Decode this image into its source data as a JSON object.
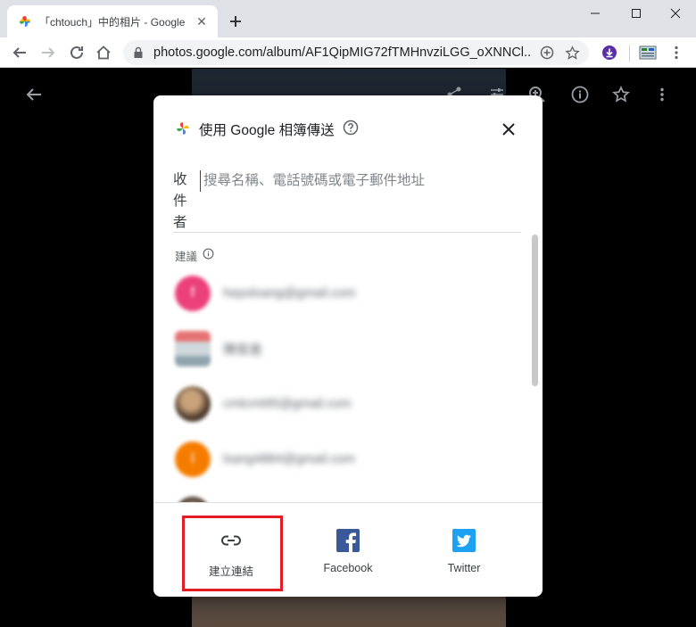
{
  "browser": {
    "tab_title": "「chtouch」中的相片 - Google",
    "url": "photos.google.com/album/AF1QipMIG72fTMHnvziLGG_oXNNCl..."
  },
  "dialog": {
    "title": "使用 Google 相簿傳送",
    "recipients_label": "收件者",
    "recipients_placeholder": "搜尋名稱、電話號碼或電子郵件地址",
    "suggestions_label": "建議",
    "contacts": [
      {
        "name": "hepoloang@gmail.com",
        "avatar_letter": "f",
        "avatar_color": "#ec407a"
      },
      {
        "name": "陳俊進",
        "avatar_letter": "",
        "avatar_color": "#b0bec5"
      },
      {
        "name": "cmtcmt95@gmail.com",
        "avatar_letter": "",
        "avatar_color": "#6d5a4a"
      },
      {
        "name": "lsang4884@gmail.com",
        "avatar_letter": "l",
        "avatar_color": "#f57c00"
      }
    ],
    "share_options": {
      "link": "建立連結",
      "facebook": "Facebook",
      "twitter": "Twitter"
    }
  },
  "colors": {
    "facebook": "#3b5998",
    "twitter": "#1da1f2",
    "highlight": "#e21d25"
  }
}
